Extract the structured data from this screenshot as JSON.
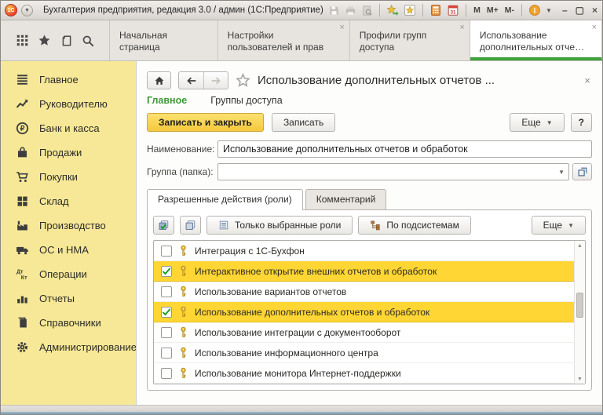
{
  "window": {
    "title": "Бухгалтерия предприятия, редакция 3.0 / админ  (1С:Предприятие)",
    "logo_text": "1С",
    "menu_buttons": [
      "M",
      "M+",
      "M-"
    ],
    "controls": {
      "minimize": "–",
      "maximize": "▢",
      "close": "×"
    }
  },
  "glyphs": {
    "close": "×",
    "dropdown": "▼",
    "scroll_up": "▲",
    "scroll_down": "▼"
  },
  "app_tabs": [
    {
      "label": "Начальная страница",
      "active": false,
      "closable": false
    },
    {
      "label": "Настройки пользователей и прав",
      "active": false,
      "closable": true
    },
    {
      "label": "Профили групп доступа",
      "active": false,
      "closable": true
    },
    {
      "label": "Использование дополнительных отче…",
      "active": true,
      "closable": true
    }
  ],
  "sidebar": {
    "items": [
      {
        "label": "Главное",
        "icon": "menu-icon"
      },
      {
        "label": "Руководителю",
        "icon": "trend-icon"
      },
      {
        "label": "Банк и касса",
        "icon": "ruble-icon"
      },
      {
        "label": "Продажи",
        "icon": "bag-icon"
      },
      {
        "label": "Покупки",
        "icon": "cart-icon"
      },
      {
        "label": "Склад",
        "icon": "grid-icon"
      },
      {
        "label": "Производство",
        "icon": "factory-icon"
      },
      {
        "label": "ОС и НМА",
        "icon": "truck-icon"
      },
      {
        "label": "Операции",
        "icon": "dtkt-icon"
      },
      {
        "label": "Отчеты",
        "icon": "chart-icon"
      },
      {
        "label": "Справочники",
        "icon": "book-icon"
      },
      {
        "label": "Администрирование",
        "icon": "gear-icon"
      }
    ]
  },
  "form": {
    "title": "Использование дополнительных отчетов ...",
    "breadcrumb": [
      {
        "label": "Главное"
      },
      {
        "label": "Группы доступа"
      }
    ],
    "actions": {
      "save_close": "Записать и закрыть",
      "save": "Записать",
      "more": "Еще",
      "help": "?"
    },
    "fields": {
      "name": {
        "label": "Наименование:",
        "value": "Использование дополнительных отчетов и обработок"
      },
      "group": {
        "label": "Группа (папка):",
        "value": ""
      }
    },
    "tabs": [
      {
        "label": "Разрешенные действия (роли)",
        "active": true
      },
      {
        "label": "Комментарий",
        "active": false
      }
    ],
    "roles_toolbar": {
      "selected_only": "Только выбранные роли",
      "by_subsystems": "По подсистемам",
      "more": "Еще"
    },
    "roles": [
      {
        "label": "Интеграция с 1С-Бухфон",
        "checked": false,
        "highlighted": false
      },
      {
        "label": "Интерактивное открытие внешних отчетов и обработок",
        "checked": true,
        "highlighted": true
      },
      {
        "label": "Использование вариантов отчетов",
        "checked": false,
        "highlighted": false
      },
      {
        "label": "Использование дополнительных отчетов и обработок",
        "checked": true,
        "highlighted": true
      },
      {
        "label": "Использование интеграции с документооборот",
        "checked": false,
        "highlighted": false
      },
      {
        "label": "Использование информационного центра",
        "checked": false,
        "highlighted": false
      },
      {
        "label": "Использование монитора Интернет-поддержки",
        "checked": false,
        "highlighted": false
      }
    ]
  },
  "colors": {
    "highlight_yellow": "#ffd633",
    "primary_button_yellow": "#f5c83e",
    "sidebar_yellow": "#f6e897",
    "accent_green": "#3fa33c",
    "check_green": "#189a1e"
  }
}
